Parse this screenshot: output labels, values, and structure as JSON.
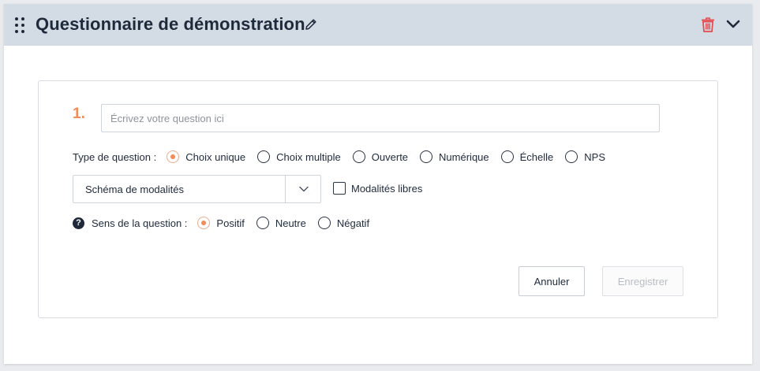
{
  "header": {
    "title": "Questionnaire de démonstration",
    "icons": [
      "drag-handle-icon",
      "pencil-icon",
      "trash-icon",
      "chevron-down-icon"
    ],
    "colors": {
      "background": "#d3dce4",
      "trash": "#e5484d"
    }
  },
  "question": {
    "number": "1.",
    "input_value": "",
    "placeholder": "Écrivez votre question ici"
  },
  "type": {
    "label": "Type de question :",
    "options": [
      "Choix unique",
      "Choix multiple",
      "Ouverte",
      "Numérique",
      "Échelle",
      "NPS"
    ],
    "selected": "Choix unique"
  },
  "schema": {
    "selected_value": "Schéma de modalités"
  },
  "free_modalities": {
    "label": "Modalités libres",
    "checked": false
  },
  "sens": {
    "label": "Sens de la question :",
    "options": [
      "Positif",
      "Neutre",
      "Négatif"
    ],
    "selected": "Positif"
  },
  "actions": {
    "cancel_label": "Annuler",
    "save_label": "Enregistrer",
    "save_enabled": false
  },
  "colors": {
    "accent": "#f28b55",
    "text": "#1e2a3b"
  }
}
